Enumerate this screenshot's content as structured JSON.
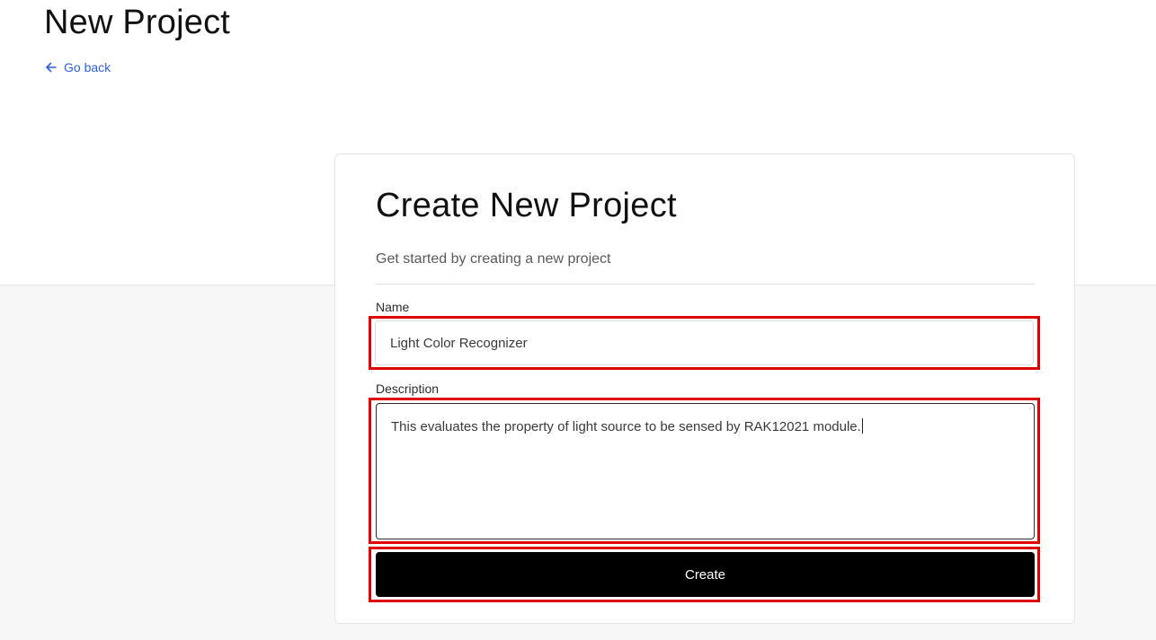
{
  "header": {
    "page_title": "New Project",
    "back_link_label": "Go back",
    "back_icon": "arrow-left-icon"
  },
  "card": {
    "title": "Create New Project",
    "subtitle": "Get started by creating a new project"
  },
  "form": {
    "name_label": "Name",
    "name_value": "Light Color Recognizer",
    "description_label": "Description",
    "description_value": "This evaluates the property of light source to be sensed by RAK12021 module.",
    "submit_label": "Create"
  },
  "colors": {
    "link": "#2f5fe0",
    "highlight": "#e10000",
    "button_bg": "#000000",
    "lower_background": "#f7f7f7"
  }
}
